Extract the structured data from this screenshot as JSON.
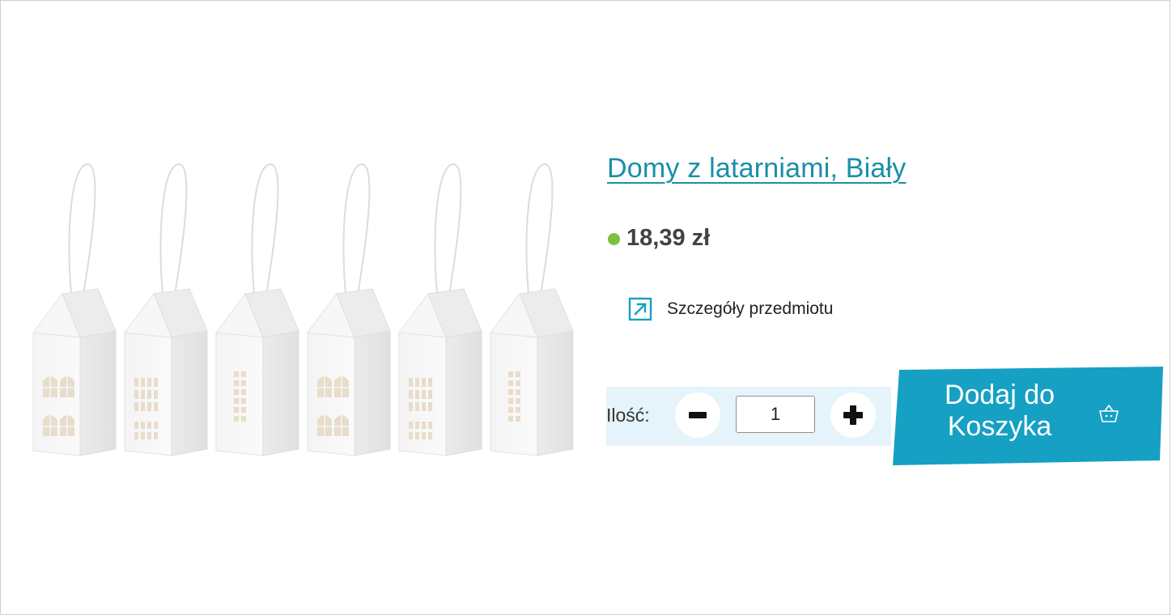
{
  "product": {
    "title": "Domy z latarniami, Biały",
    "price": "18,39 zł",
    "image_name": "product-image",
    "image_alt": "Domy z latarniami, Biały"
  },
  "details_link": {
    "label": "Szczegóły przedmiotu",
    "icon": "external-arrow-icon"
  },
  "quantity": {
    "label": "Ilość:",
    "value": "1",
    "minus_icon": "minus-icon",
    "plus_icon": "plus-icon"
  },
  "cart": {
    "label": "Dodaj do Koszyka",
    "icon": "basket-icon"
  },
  "colors": {
    "accent": "#1a8fa8",
    "button_bg": "#16a0c4",
    "price_dot": "#7ac142",
    "qty_bg": "#e4f4fa"
  }
}
